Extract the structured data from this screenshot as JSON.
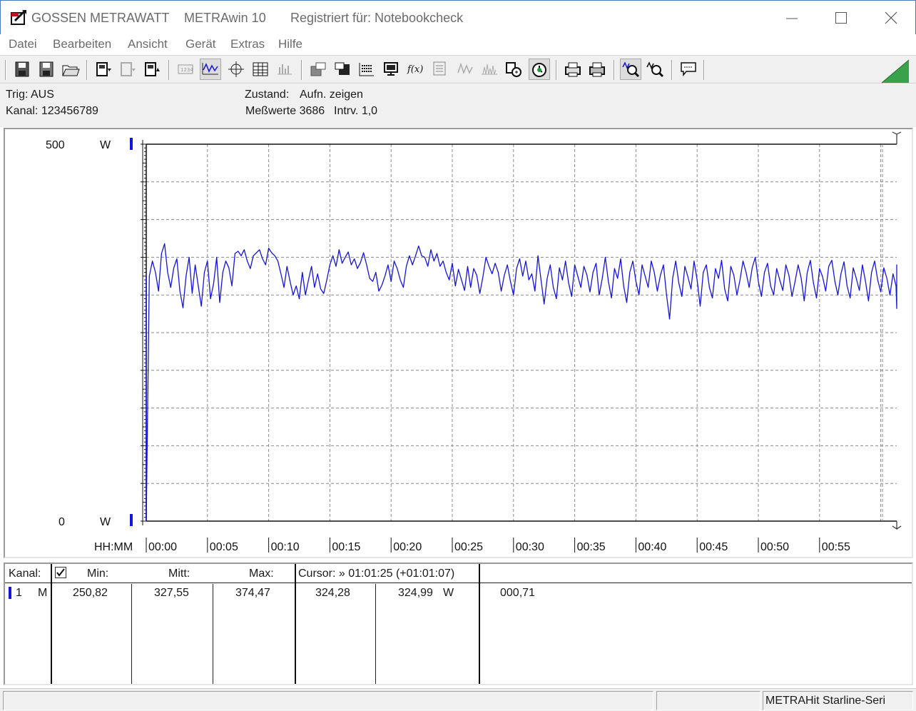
{
  "window": {
    "brand": "GOSSEN METRAWATT",
    "app_title": "METRAwin 10",
    "registered": "Registriert für: Notebookcheck"
  },
  "menu": [
    "Datei",
    "Bearbeiten",
    "Ansicht",
    "Gerät",
    "Extras",
    "Hilfe"
  ],
  "info": {
    "trig": "Trig: AUS",
    "kanal": "Kanal: 123456789",
    "zustand_label": "Zustand:",
    "zustand_value": "Aufn. zeigen",
    "messwerte": "Meßwerte 3686",
    "intrv": "Intrv. 1,0"
  },
  "chart_data": {
    "type": "line",
    "title": "",
    "ylabel_top": "500",
    "ylabel_bottom": "0",
    "yunit": "W",
    "xlabel": "HH:MM",
    "ylim": [
      0,
      500
    ],
    "xlim_minutes": [
      0,
      61.4
    ],
    "x_ticks": [
      "00:00",
      "00:05",
      "00:10",
      "00:15",
      "00:20",
      "00:25",
      "00:30",
      "00:35",
      "00:40",
      "00:45",
      "00:50",
      "00:55"
    ],
    "grid": true,
    "series": [
      {
        "color": "#1515d8",
        "x_minutes_step": 0.25,
        "values": [
          0,
          325,
          345,
          330,
          305,
          355,
          368,
          330,
          310,
          336,
          348,
          305,
          283,
          325,
          350,
          302,
          340,
          312,
          285,
          330,
          345,
          295,
          315,
          350,
          290,
          330,
          345,
          336,
          312,
          355,
          358,
          352,
          360,
          345,
          335,
          352,
          356,
          360,
          348,
          340,
          362,
          356,
          352,
          345,
          328,
          310,
          338,
          318,
          300,
          312,
          295,
          330,
          300,
          320,
          338,
          310,
          328,
          308,
          302,
          320,
          340,
          352,
          338,
          360,
          342,
          350,
          357,
          340,
          348,
          335,
          343,
          356,
          340,
          322,
          318,
          330,
          305,
          313,
          325,
          340,
          318,
          345,
          335,
          320,
          310,
          338,
          352,
          340,
          352,
          365,
          352,
          350,
          338,
          360,
          345,
          355,
          338,
          345,
          330,
          320,
          342,
          312,
          334,
          320,
          306,
          338,
          310,
          335,
          326,
          302,
          324,
          350,
          338,
          328,
          342,
          330,
          305,
          326,
          340,
          318,
          300,
          335,
          348,
          325,
          345,
          320,
          328,
          305,
          352,
          320,
          288,
          322,
          340,
          310,
          295,
          336,
          320,
          345,
          316,
          298,
          340,
          325,
          310,
          338,
          326,
          304,
          330,
          342,
          300,
          322,
          350,
          318,
          296,
          335,
          322,
          348,
          312,
          290,
          330,
          345,
          318,
          300,
          340,
          325,
          310,
          345,
          330,
          305,
          326,
          340,
          300,
          268,
          322,
          345,
          316,
          298,
          338,
          324,
          308,
          345,
          320,
          285,
          330,
          340,
          310,
          296,
          335,
          322,
          346,
          308,
          292,
          338,
          326,
          300,
          320,
          345,
          330,
          310,
          336,
          350,
          318,
          298,
          330,
          342,
          312,
          300,
          335,
          320,
          306,
          340,
          326,
          298,
          318,
          340,
          322,
          292,
          330,
          346,
          316,
          296,
          335,
          324,
          305,
          338,
          346,
          318,
          300,
          328,
          344,
          312,
          296,
          336,
          322,
          306,
          340,
          318,
          292,
          330,
          345,
          320,
          304,
          336,
          322,
          300,
          328,
          312,
          282,
          318,
          335,
          306,
          322,
          340,
          312,
          296,
          330,
          318,
          325
        ]
      }
    ]
  },
  "table": {
    "headers": {
      "kanal": "Kanal:",
      "check": "✓",
      "min": "Min:",
      "mitt": "Mitt:",
      "max": "Max:",
      "cursor": "Cursor: » 01:01:25 (+01:01:07)"
    },
    "rows": [
      {
        "channel": "1",
        "mode": "M",
        "min": "250,82",
        "mitt": "327,55",
        "max": "374,47",
        "cursor1": "324,28",
        "cursor2": "324,99",
        "unit": "W",
        "diff": "000,71"
      }
    ]
  },
  "status": {
    "pane1": "",
    "pane2": "",
    "pane3": "METRAHit Starline-Seri"
  },
  "colors": {
    "trace": "#1515d8",
    "channel_marker": "#1515d8",
    "grid": "#888888",
    "corner_triangle": "#3aa24a"
  }
}
